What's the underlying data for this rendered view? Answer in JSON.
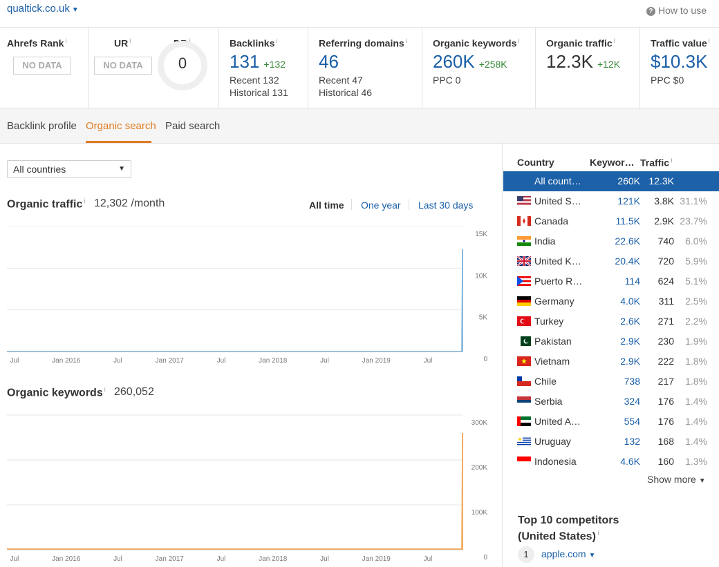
{
  "header": {
    "site": "qualtick.co.uk",
    "how_to_use": "How to use"
  },
  "metrics": {
    "ahrefs_rank": {
      "label": "Ahrefs Rank",
      "value": "NO DATA"
    },
    "ur": {
      "label": "UR",
      "value": "NO DATA"
    },
    "dr": {
      "label": "DR",
      "value": "0"
    },
    "backlinks": {
      "label": "Backlinks",
      "value": "131",
      "delta": "+132",
      "recent": "Recent 132",
      "historical": "Historical 131"
    },
    "referring_domains": {
      "label": "Referring domains",
      "value": "46",
      "recent": "Recent 47",
      "historical": "Historical 46"
    },
    "organic_keywords": {
      "label": "Organic keywords",
      "value": "260K",
      "delta": "+258K",
      "ppc": "PPC 0"
    },
    "organic_traffic": {
      "label": "Organic traffic",
      "value": "12.3K",
      "delta": "+12K"
    },
    "traffic_value": {
      "label": "Traffic value",
      "value": "$10.3K",
      "ppc": "PPC $0"
    }
  },
  "tabs": [
    "Backlink profile",
    "Organic search",
    "Paid search"
  ],
  "filter": {
    "country_select": "All countries"
  },
  "organic_traffic_section": {
    "title": "Organic traffic",
    "value": "12,302 /month"
  },
  "periods": [
    "All time",
    "One year",
    "Last 30 days"
  ],
  "organic_keywords_section": {
    "title": "Organic keywords",
    "value": "260,052"
  },
  "chart_data": [
    {
      "type": "area",
      "title": "Organic traffic",
      "color": "#7aaed6",
      "x_ticks": [
        "Jul",
        "Jan 2016",
        "Jul",
        "Jan 2017",
        "Jul",
        "Jan 2018",
        "Jul",
        "Jan 2019",
        "Jul"
      ],
      "y_ticks": [
        "15K",
        "10K",
        "5K",
        "0"
      ],
      "ylim": [
        0,
        15000
      ],
      "x": [
        "2015-07",
        "2016-01",
        "2016-07",
        "2017-01",
        "2017-07",
        "2018-01",
        "2018-07",
        "2019-01",
        "2019-07",
        "2019-10",
        "2019-11"
      ],
      "values": [
        0,
        0,
        0,
        0,
        0,
        0,
        0,
        0,
        0,
        0,
        12302
      ]
    },
    {
      "type": "area",
      "title": "Organic keywords",
      "color": "#f0a04b",
      "x_ticks": [
        "Jul",
        "Jan 2016",
        "Jul",
        "Jan 2017",
        "Jul",
        "Jan 2018",
        "Jul",
        "Jan 2019",
        "Jul"
      ],
      "y_ticks": [
        "300K",
        "200K",
        "100K",
        "0"
      ],
      "ylim": [
        0,
        300000
      ],
      "x": [
        "2015-07",
        "2016-01",
        "2016-07",
        "2017-01",
        "2017-07",
        "2018-01",
        "2018-07",
        "2019-01",
        "2019-07",
        "2019-10",
        "2019-11"
      ],
      "values": [
        1500,
        1500,
        1500,
        1500,
        1500,
        1500,
        1500,
        1500,
        1500,
        1500,
        260052
      ]
    }
  ],
  "country_table": {
    "headers": {
      "country": "Country",
      "keywords": "Keywor…",
      "traffic": "Traffic"
    },
    "rows": [
      {
        "name": "All count…",
        "keywords": "260K",
        "traffic": "12.3K",
        "pct": "",
        "flag": "none"
      },
      {
        "name": "United S…",
        "keywords": "121K",
        "traffic": "3.8K",
        "pct": "31.1%",
        "flag": "us"
      },
      {
        "name": "Canada",
        "keywords": "11.5K",
        "traffic": "2.9K",
        "pct": "23.7%",
        "flag": "ca"
      },
      {
        "name": "India",
        "keywords": "22.6K",
        "traffic": "740",
        "pct": "6.0%",
        "flag": "in"
      },
      {
        "name": "United K…",
        "keywords": "20.4K",
        "traffic": "720",
        "pct": "5.9%",
        "flag": "gb"
      },
      {
        "name": "Puerto R…",
        "keywords": "114",
        "traffic": "624",
        "pct": "5.1%",
        "flag": "pr"
      },
      {
        "name": "Germany",
        "keywords": "4.0K",
        "traffic": "311",
        "pct": "2.5%",
        "flag": "de"
      },
      {
        "name": "Turkey",
        "keywords": "2.6K",
        "traffic": "271",
        "pct": "2.2%",
        "flag": "tr"
      },
      {
        "name": "Pakistan",
        "keywords": "2.9K",
        "traffic": "230",
        "pct": "1.9%",
        "flag": "pk"
      },
      {
        "name": "Vietnam",
        "keywords": "2.9K",
        "traffic": "222",
        "pct": "1.8%",
        "flag": "vn"
      },
      {
        "name": "Chile",
        "keywords": "738",
        "traffic": "217",
        "pct": "1.8%",
        "flag": "cl"
      },
      {
        "name": "Serbia",
        "keywords": "324",
        "traffic": "176",
        "pct": "1.4%",
        "flag": "rs"
      },
      {
        "name": "United A…",
        "keywords": "554",
        "traffic": "176",
        "pct": "1.4%",
        "flag": "ae"
      },
      {
        "name": "Uruguay",
        "keywords": "132",
        "traffic": "168",
        "pct": "1.4%",
        "flag": "uy"
      },
      {
        "name": "Indonesia",
        "keywords": "4.6K",
        "traffic": "160",
        "pct": "1.3%",
        "flag": "id"
      }
    ],
    "show_more": "Show more"
  },
  "competitors": {
    "title_line1": "Top 10 competitors",
    "title_line2": "(United States)",
    "items": [
      {
        "rank": "1",
        "domain": "apple.com"
      }
    ]
  },
  "colors": {
    "accent": "#e07b20",
    "link": "#1a5fa8",
    "selected_row": "#1d61a8",
    "positive": "#3a8a3a"
  }
}
